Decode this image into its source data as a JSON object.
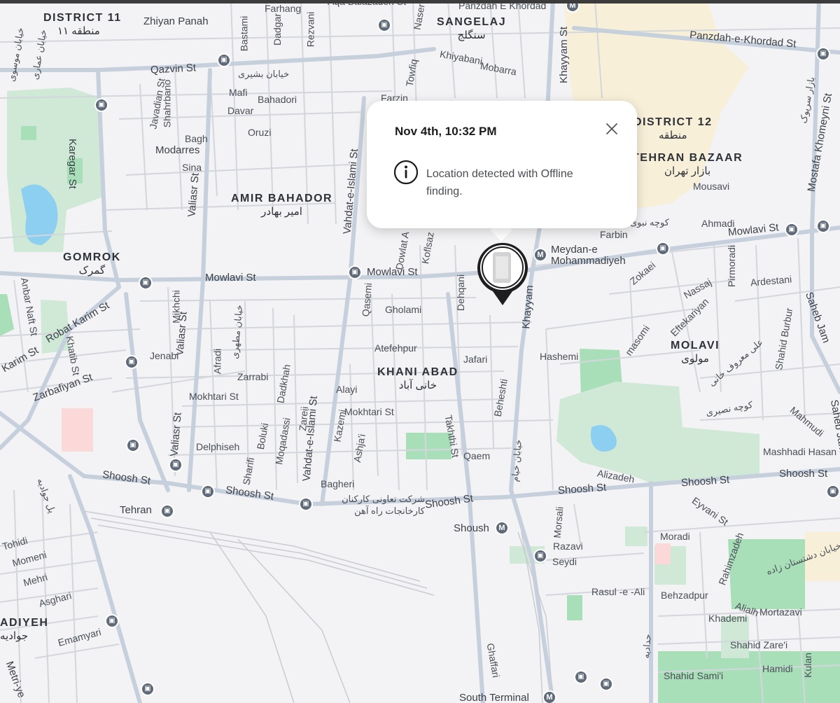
{
  "popup": {
    "date": "Nov 4th, 10:32 PM",
    "message": "Location detected with Offline finding.",
    "close_icon": "close-icon",
    "info_icon": "info-icon"
  },
  "pin": {
    "icon": "device-location-pin-icon"
  },
  "districts": {
    "d11": {
      "name": "DISTRICT 11",
      "fa": "منطقه ۱۱"
    },
    "sangelaj": {
      "name": "SANGELAJ",
      "fa": "سنگلج"
    },
    "d12": {
      "name": "DISTRICT 12",
      "fa": "منطقه"
    },
    "bazaar": {
      "name": "TEHRAN BAZAAR",
      "fa": "بازار تهران"
    },
    "amir": {
      "name": "AMIR BAHADOR",
      "fa": "امیر بهادر"
    },
    "gomrok": {
      "name": "GOMROK",
      "fa": "گمرک"
    },
    "khani": {
      "name": "KHANI ABAD",
      "fa": "خانی آباد"
    },
    "molavi": {
      "name": "MOLAVI",
      "fa": "مولوی"
    },
    "adiyeh": {
      "name": "ADIYEH",
      "fa": "جوادیه"
    }
  },
  "streets": {
    "zhiyan": "Zhiyan Panah",
    "farhang": "Farhang",
    "panzdah_top": "Panzdah E Khordad",
    "panzdah_e": "Panzdah-e-Khordad St",
    "qazvin": "Qazvin St",
    "bashiri_fa": "خیابان بشیری",
    "mafi": "Mafi",
    "bahadori": "Bahadori",
    "davar": "Davar",
    "oruzi": "Oruzi",
    "bagh": "Bagh",
    "modarres": "Modarres",
    "sina": "Sina",
    "karegar": "Karegar St",
    "javadian": "Javadian St",
    "shahrbano": "Shahrbano",
    "bastami": "Bastami",
    "dadgar": "Dadgar",
    "rezvani": "Rezvani",
    "naser": "Naser",
    "khiyabani": "Khiyabani",
    "mobarra": "Mobarra",
    "towfiq": "Towfiq",
    "farzin": "Farzin",
    "khayyam_top": "Khayyam St",
    "mostafa": "Mostafa Khomeyni St",
    "valiasr_mid": "Valiasr St",
    "vahdat_top": "Vahdat-e-Islami St",
    "dowlat": "Dowlat A",
    "koflsaz": "Koflsaz",
    "mowlavi_mid": "Mowlavi St",
    "mowlavi_left": "Mowlavi St",
    "mowlavi_right": "Mowlavi St",
    "meydan": "Meydan-e",
    "mohammadiyeh": "Mohammadiyeh",
    "farbin": "Farbin",
    "ahmadi": "Ahmadi",
    "mousavi": "Mousavi",
    "pirmoradi": "Pirmoradi",
    "ardestani": "Ardestani",
    "zokaei": "Zokaei",
    "nassaj": "Nassaj",
    "eftekariyan": "Eftekariyan",
    "masomi": "masomi",
    "hashemi": "Hashemi",
    "khayyam_mid": "Khayyam",
    "saheb_jam": "Saheb Jam",
    "saheb_jam2": "Saheb Jam",
    "shahid_burbur": "Shahid Burbur",
    "mahmudi": "Mahmudi",
    "mashhadi": "Mashhadi Hasan",
    "qasemi": "Qasemi",
    "gholami": "Gholami",
    "dehqani": "Dehqani",
    "atefehpur": "Atefehpur",
    "jafari": "Jafari",
    "beheshti": "Beheshti",
    "alayi": "Alayi",
    "mokhtari_left": "Mokhtari St",
    "mokhtari_mid": "Mokhtari St",
    "zarrabi": "Zarrabi",
    "dadkhah": "Dadkhah",
    "afradi": "Afradi",
    "mikhchi": "Mikhchi",
    "valiasr_low": "Valiasr St",
    "valiasr_low2": "Valiasr St",
    "jenabi": "Jenabi",
    "robat": "Robat Karim St",
    "anbar": "Anbar Naft St",
    "khatib": "Khatib St",
    "karim": "Karim St",
    "zarbafiyan": "Zarbafiyan St",
    "delphiseh": "Delphiseh",
    "boluki": "Boluki",
    "moqadassi": "Moqadassi",
    "zareii": "Zareii",
    "kazemi": "Kazemi",
    "ashjai": "Ashja'i",
    "sharifi": "Sharifi",
    "vahdat_low": "Vahdat-e-Islami St",
    "takhthi": "Takhthi St",
    "qaem": "Qaem",
    "bagheri": "Bagheri",
    "shoosh_left": "Shoosh St",
    "shoosh_mid": "Shoosh St",
    "shoosh_c": "Shoosh St",
    "shoosh_r": "Shoosh St",
    "shoosh_rr": "Shoosh St",
    "alizadeh": "Alizadeh",
    "tehran": "Tehran",
    "company_fa": "شرکت تعاونی کارکنان کارخانجات راه آهن",
    "shoush_station": "Shoush",
    "morsali": "Morsali",
    "razavi": "Razavi",
    "seydi": "Seydi",
    "rasul": "Rasul -e -Ali",
    "behzadpur": "Behzadpur",
    "eyvani": "Eyvani St",
    "moradi": "Moradi",
    "rahimzadeh": "Rahimzadeh",
    "alialh": "Alialh",
    "khademi": "Khademi",
    "mortazavi": "Mortazavi",
    "zarei": "Shahid Zare'i",
    "hamidi": "Hamidi",
    "kulan": "Kulan",
    "samii": "Shahid Sami'i",
    "ghaffari": "Ghaffari",
    "south_terminal": "South Terminal",
    "tohidi": "Tohidi",
    "momeni": "Momeni",
    "mehri": "Mehri",
    "asghari": "Asghari",
    "emamyari": "Emamyari",
    "metri": "Metri-ye",
    "aqa": "Aqa Balazadeh St",
    "khayyam_fa": "خیابان خیام",
    "mahmoud_fa": "خیابان مطهری",
    "ali_fa": "کوچه نصیری",
    "molavi_fa2": "علی معروف خانی",
    "sangelaj_fa": "کوچه نبوی",
    "jalil_fa": "خیابان موسوی",
    "ammari_fa": "خیابان عماری",
    "bazar_fa": "بازار سرپوک",
    "jadeh_fa": "پل جواديه",
    "dashtestan_fa": "خیابان دشتستان زاده",
    "hadid_fa": "حدادیه"
  }
}
